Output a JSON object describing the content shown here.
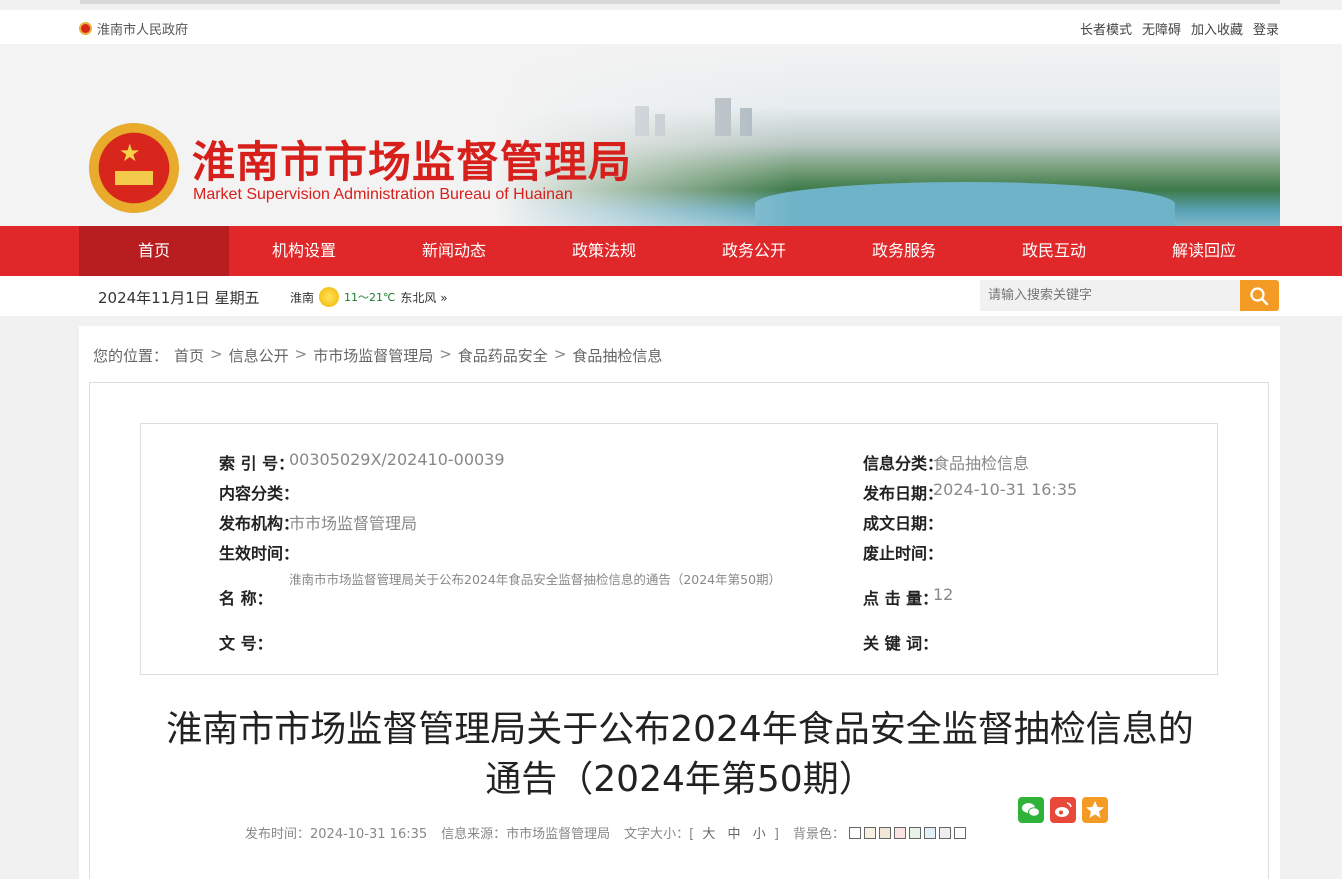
{
  "topbar": {
    "gov_link": "淮南市人民政府",
    "links": [
      "长者模式",
      "无障碍",
      "加入收藏",
      "登录"
    ]
  },
  "header": {
    "title_cn": "淮南市市场监督管理局",
    "title_en": "Market Supervision Administration Bureau of Huainan"
  },
  "nav": {
    "items": [
      "首页",
      "机构设置",
      "新闻动态",
      "政策法规",
      "政务公开",
      "政务服务",
      "政民互动",
      "解读回应"
    ],
    "active_index": 0
  },
  "infobar": {
    "date": "2024年11月1日  星期五",
    "city": "淮南",
    "temp": "11～21℃",
    "wind": "东北风 »"
  },
  "search": {
    "placeholder": "请输入搜索关键字"
  },
  "breadcrumb": {
    "prefix": "您的位置：",
    "items": [
      "首页",
      "信息公开",
      "市市场监督管理局",
      "食品药品安全",
      "食品抽检信息"
    ],
    "separator": ">"
  },
  "meta": {
    "index_label": "索  引  号：",
    "index_value": "00305029X/202410-00039",
    "category_label": "信息分类：",
    "category_value": "食品抽检信息",
    "content_label": "内容分类：",
    "content_value": "",
    "pubdate_label": "发布日期：",
    "pubdate_value": "2024-10-31 16:35",
    "org_label": "发布机构：",
    "org_value": "市市场监督管理局",
    "created_label": "成文日期：",
    "created_value": "",
    "effective_label": "生效时间：",
    "effective_value": "",
    "expire_label": "废止时间：",
    "expire_value": "",
    "name_label": "名      称：",
    "name_value": "淮南市市场监督管理局关于公布2024年食品安全监督抽检信息的通告（2024年第50期）",
    "clicks_label": "点  击  量：",
    "clicks_value": "12",
    "docno_label": "文      号：",
    "docno_value": "",
    "keywords_label": "关  键  词：",
    "keywords_value": ""
  },
  "article": {
    "title_line1": "淮南市市场监督管理局关于公布2024年食品安全监督抽检信息的",
    "title_line2": "通告（2024年第50期）",
    "pub_time": "发布时间：2024-10-31 16:35",
    "source": "信息来源：市市场监督管理局",
    "font_size_label": "文字大小：[",
    "font_large": "大",
    "font_medium": "中",
    "font_small": "小",
    "font_close": "]",
    "bg_label": "背景色：",
    "bg_colors": [
      "#ffffff",
      "#f7efe2",
      "#f2e7d6",
      "#fbe3e3",
      "#e6f3e6",
      "#e1f0f6",
      "#eeeeee",
      "#ffffff"
    ]
  },
  "share": {
    "wechat_color": "#2fb23a",
    "weibo_color": "#e8483a",
    "fav_color": "#f39b25"
  }
}
